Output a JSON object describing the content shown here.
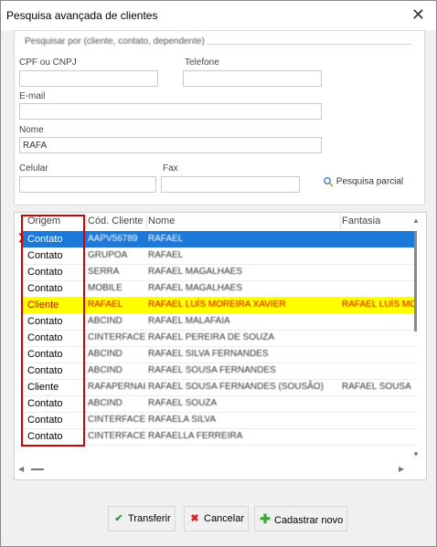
{
  "window": {
    "title": "Pesquisa avançada de clientes",
    "close_glyph": "✕"
  },
  "search": {
    "legend": "Pesquisar por (cliente, contato, dependente)",
    "cpf_label": "CPF ou CNPJ",
    "cpf_value": "",
    "phone_label": "Telefone",
    "phone_value": "",
    "email_label": "E-mail",
    "email_value": "",
    "name_label": "Nome",
    "name_value": "RAFA",
    "mobile_label": "Celular",
    "mobile_value": "",
    "fax_label": "Fax",
    "fax_value": "",
    "partial_label": "Pesquisa parcial"
  },
  "grid": {
    "headers": [
      "Origem",
      "Cód. Cliente",
      "Nome",
      "Fantasia"
    ],
    "rows": [
      {
        "origem": "Contato",
        "codigo": "AAPV56789",
        "nome": "RAFAEL",
        "fantasia": ""
      },
      {
        "origem": "Contato",
        "codigo": "GRUPOA",
        "nome": "RAFAEL",
        "fantasia": ""
      },
      {
        "origem": "Contato",
        "codigo": "SERRA",
        "nome": "RAFAEL MAGALHAES",
        "fantasia": ""
      },
      {
        "origem": "Contato",
        "codigo": "MOBILE",
        "nome": "RAFAEL MAGALHAES",
        "fantasia": ""
      },
      {
        "origem": "Cliente",
        "codigo": "RAFAEL",
        "nome": "RAFAEL LUÍS MOREIRA XAVIER",
        "fantasia": "RAFAEL LUÍS MO"
      },
      {
        "origem": "Contato",
        "codigo": "ABCIND",
        "nome": "RAFAEL MALAFAIA",
        "fantasia": ""
      },
      {
        "origem": "Contato",
        "codigo": "CINTERFACE",
        "nome": "RAFAEL PEREIRA DE SOUZA",
        "fantasia": ""
      },
      {
        "origem": "Contato",
        "codigo": "ABCIND",
        "nome": "RAFAEL SILVA FERNANDES",
        "fantasia": ""
      },
      {
        "origem": "Contato",
        "codigo": "ABCIND",
        "nome": "RAFAEL SOUSA FERNANDES",
        "fantasia": ""
      },
      {
        "origem": "Cliente",
        "codigo": "RAFAPERNAI",
        "nome": "RAFAEL SOUSA FERNANDES (SOUSÃO)",
        "fantasia": "RAFAEL SOUSA"
      },
      {
        "origem": "Contato",
        "codigo": "ABCIND",
        "nome": "RAFAEL SOUZA",
        "fantasia": ""
      },
      {
        "origem": "Contato",
        "codigo": "CINTERFACE",
        "nome": "RAFAELA SILVA",
        "fantasia": ""
      },
      {
        "origem": "Contato",
        "codigo": "CINTERFACE",
        "nome": "RAFAELLA FERREIRA",
        "fantasia": ""
      }
    ]
  },
  "buttons": {
    "transfer": "Transferir",
    "cancel": "Cancelar",
    "new": "Cadastrar novo"
  },
  "colors": {
    "selected_row": "#1e78d7",
    "highlight_row": "#ffff00",
    "highlight_text": "#e00000",
    "annotation_box": "#d40000"
  }
}
